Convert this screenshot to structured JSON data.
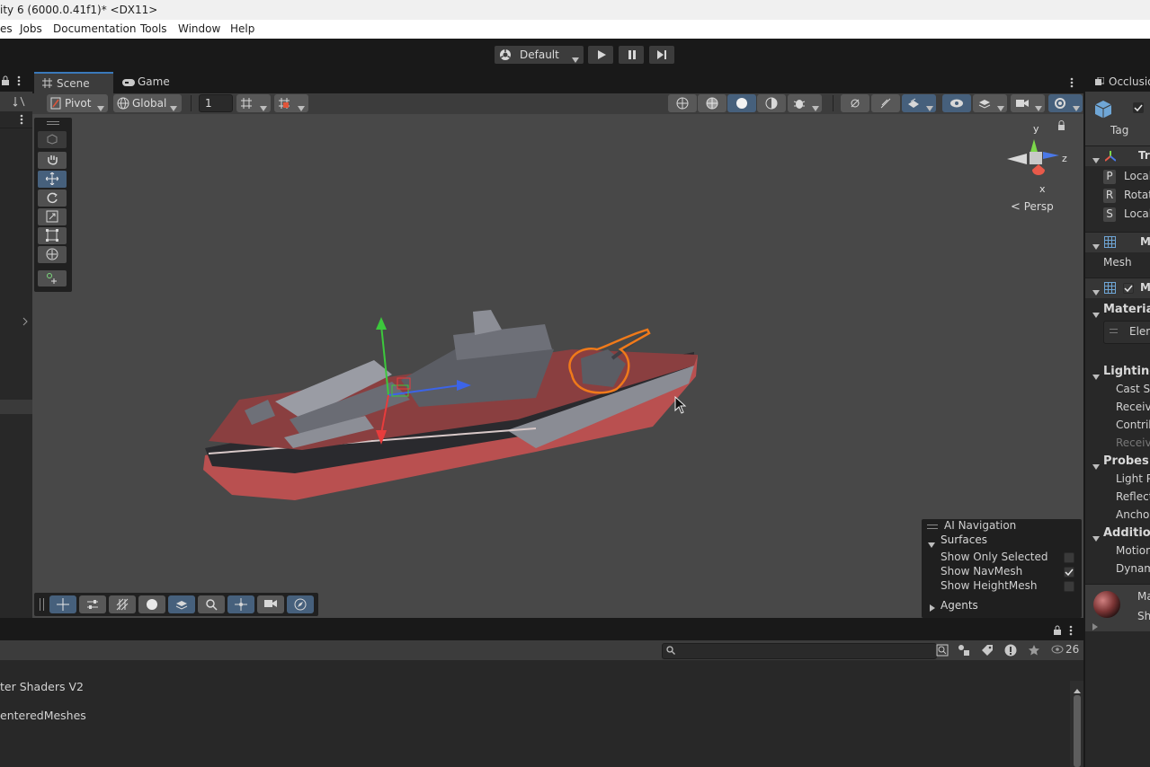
{
  "window": {
    "title": "ity 6 (6000.0.41f1)* <DX11>"
  },
  "menu": {
    "items": [
      "es",
      "Jobs",
      "Documentation",
      "Tools",
      "Window",
      "Help"
    ]
  },
  "toolbar": {
    "layout_label": "Default"
  },
  "scene_tabs": {
    "scene": "Scene",
    "game": "Game"
  },
  "scene_toolbar": {
    "pivot": "Pivot",
    "global": "Global",
    "grid_value": "1"
  },
  "gizmo": {
    "y": "y",
    "z": "z",
    "x": "x",
    "projection": "Persp"
  },
  "ai_navigation": {
    "title": "AI Navigation",
    "surfaces": "Surfaces",
    "options": [
      {
        "label": "Show Only Selected",
        "checked": false
      },
      {
        "label": "Show NavMesh",
        "checked": true
      },
      {
        "label": "Show HeightMesh",
        "checked": false
      }
    ],
    "agents": "Agents"
  },
  "console": {
    "count": "26",
    "lines": [
      "ter Shaders V2",
      "enteredMeshes"
    ]
  },
  "inspector": {
    "tab": "Occlusio",
    "tag": "Tag",
    "transform": {
      "header": "Tr",
      "rows": [
        {
          "key": "P",
          "label": "Local"
        },
        {
          "key": "R",
          "label": "Rotat"
        },
        {
          "key": "S",
          "label": "Local"
        }
      ]
    },
    "mesh_filter": {
      "header": "M",
      "mesh_label": "Mesh"
    },
    "mesh_renderer": {
      "header": "M"
    },
    "materials": {
      "header": "Material",
      "element": "Elem"
    },
    "lighting": {
      "header": "Lighting",
      "rows": [
        "Cast S",
        "Receiv",
        "Contrib",
        "Receiv"
      ]
    },
    "probes": {
      "header": "Probes",
      "rows": [
        "Light P",
        "Reflect",
        "Anchor"
      ]
    },
    "additional": {
      "header": "Addition",
      "rows": [
        "Motion",
        "Dynam"
      ]
    },
    "material_preview": {
      "name": "Ma",
      "shader": "Sha"
    }
  }
}
